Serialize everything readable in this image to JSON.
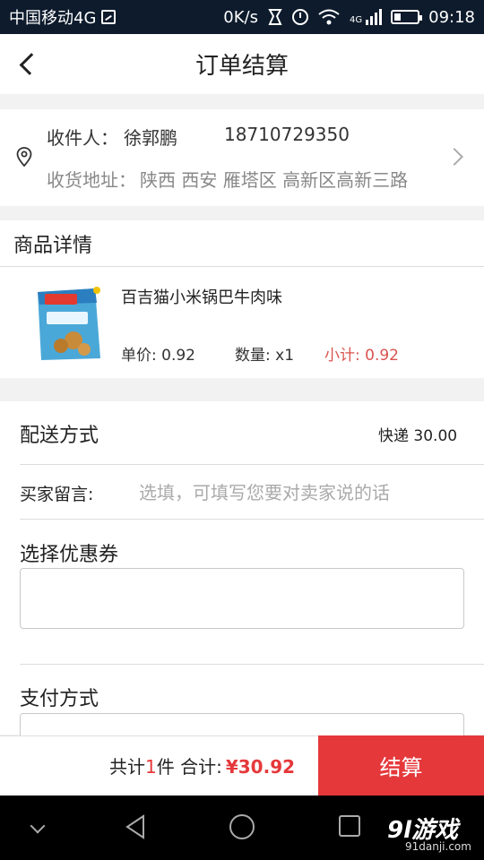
{
  "status_bar": {
    "carrier": "中国移动4G",
    "speed": "0K/s",
    "network": "4G",
    "time": "09:18"
  },
  "header": {
    "title": "订单结算"
  },
  "address": {
    "recipient_label": "收件人：",
    "recipient_name": "徐郭鹏",
    "phone": "18710729350",
    "address_label": "收货地址：",
    "address": "陕西 西安 雁塔区 高新区高新三路"
  },
  "goods": {
    "section_title": "商品详情",
    "product_name": "百吉猫小米锅巴牛肉味",
    "unit_price": "单价:  0.92",
    "quantity": "数量:  x1",
    "subtotal": "小计:  0.92"
  },
  "form": {
    "delivery_label": "配送方式",
    "delivery_value": "快递 30.00",
    "message_label": "买家留言:",
    "message_placeholder": "选填，可填写您要对卖家说的话",
    "coupon_label": "选择优惠券",
    "payment_label": "支付方式"
  },
  "bottom_bar": {
    "total_prefix": "共计",
    "total_count": "1",
    "total_middle": "件 合计:",
    "total_amount": "¥30.92",
    "checkout_label": "结算"
  },
  "watermark": {
    "logo": "9l游戏",
    "site": "91danji.com"
  },
  "colors": {
    "accent": "#e5383b",
    "status_bar": "#0d1b2c"
  },
  "icons": [
    "back-icon",
    "location-pin-icon",
    "chevron-right-icon",
    "nav-back-icon",
    "nav-home-icon",
    "nav-recent-icon"
  ]
}
